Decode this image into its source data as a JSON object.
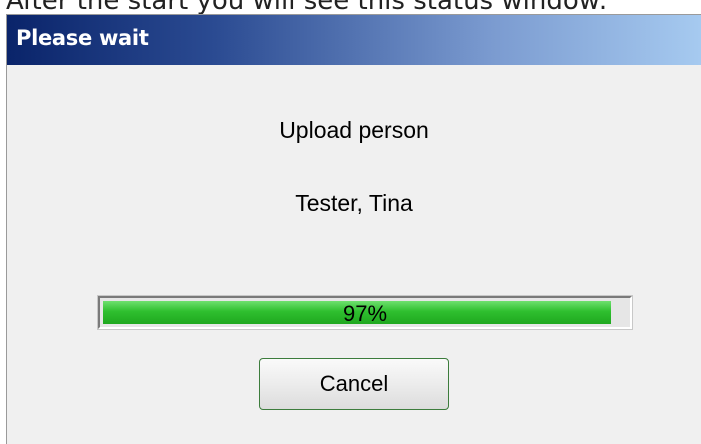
{
  "caption": "After the start you will see this status window:",
  "dialog": {
    "title": "Please wait",
    "status_line": "Upload person",
    "person_name": "Tester, Tina",
    "progress": {
      "percent": 97,
      "label": "97%"
    },
    "cancel_label": "Cancel"
  }
}
